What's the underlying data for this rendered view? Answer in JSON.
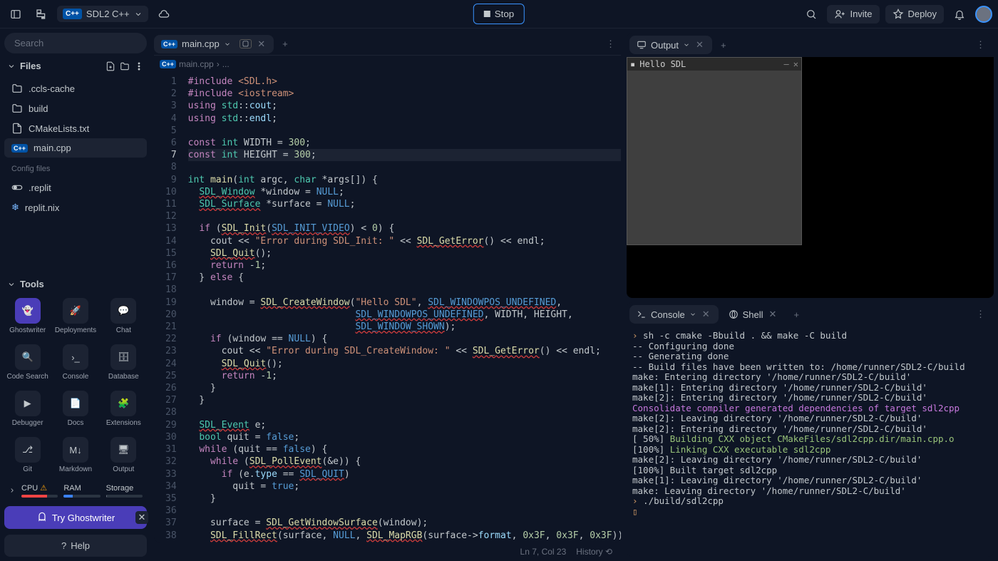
{
  "project": {
    "name": "SDL2 C++"
  },
  "topbar": {
    "stop": "Stop",
    "invite": "Invite",
    "deploy": "Deploy"
  },
  "sidebar": {
    "search_placeholder": "Search",
    "files_label": "Files",
    "files": [
      {
        "name": ".ccls-cache",
        "icon": "folder"
      },
      {
        "name": "build",
        "icon": "folder"
      },
      {
        "name": "CMakeLists.txt",
        "icon": "file"
      },
      {
        "name": "main.cpp",
        "icon": "cpp",
        "active": true
      }
    ],
    "config_label": "Config files",
    "config_files": [
      {
        "name": ".replit",
        "icon": "toggle"
      },
      {
        "name": "replit.nix",
        "icon": "nix"
      }
    ],
    "tools_label": "Tools",
    "tools": [
      {
        "name": "Ghostwriter",
        "accent": true
      },
      {
        "name": "Deployments"
      },
      {
        "name": "Chat"
      },
      {
        "name": "Code Search"
      },
      {
        "name": "Console"
      },
      {
        "name": "Database"
      },
      {
        "name": "Debugger"
      },
      {
        "name": "Docs"
      },
      {
        "name": "Extensions"
      },
      {
        "name": "Git"
      },
      {
        "name": "Markdown"
      },
      {
        "name": "Output"
      }
    ],
    "resources": {
      "cpu": {
        "label": "CPU",
        "pct": 70,
        "color": "#ef4444"
      },
      "ram": {
        "label": "RAM",
        "pct": 25,
        "color": "#3b82f6"
      },
      "storage": {
        "label": "Storage",
        "pct": 3,
        "color": "#6b7280"
      }
    },
    "ghostwriter_cta": "Try Ghostwriter",
    "help": "Help"
  },
  "editor": {
    "tab_name": "main.cpp",
    "breadcrumb": [
      "main.cpp",
      "..."
    ],
    "status": {
      "pos": "Ln 7, Col 23",
      "history": "History"
    }
  },
  "output": {
    "tab": "Output",
    "window_title": "Hello SDL"
  },
  "console": {
    "tabs": [
      {
        "name": "Console"
      },
      {
        "name": "Shell"
      }
    ],
    "lines": [
      {
        "prompt": "›",
        "text": " sh -c cmake -Bbuild . && make -C build"
      },
      {
        "text": "-- Configuring done"
      },
      {
        "text": "-- Generating done"
      },
      {
        "text": "-- Build files have been written to: /home/runner/SDL2-C/build"
      },
      {
        "text": "make: Entering directory '/home/runner/SDL2-C/build'"
      },
      {
        "text": "make[1]: Entering directory '/home/runner/SDL2-C/build'"
      },
      {
        "text": "make[2]: Entering directory '/home/runner/SDL2-C/build'"
      },
      {
        "cls": "mg",
        "text": "Consolidate compiler generated dependencies of target sdl2cpp"
      },
      {
        "text": "make[2]: Leaving directory '/home/runner/SDL2-C/build'"
      },
      {
        "text": "make[2]: Entering directory '/home/runner/SDL2-C/build'"
      },
      {
        "prefix": "[ 50%] ",
        "cls": "gr",
        "text": "Building CXX object CMakeFiles/sdl2cpp.dir/main.cpp.o"
      },
      {
        "prefix": "[100%] ",
        "cls": "gr",
        "text": "Linking CXX executable sdl2cpp"
      },
      {
        "text": "make[2]: Leaving directory '/home/runner/SDL2-C/build'"
      },
      {
        "text": "[100%] Built target sdl2cpp"
      },
      {
        "text": "make[1]: Leaving directory '/home/runner/SDL2-C/build'"
      },
      {
        "text": "make: Leaving directory '/home/runner/SDL2-C/build'"
      },
      {
        "prompt": "›",
        "text": " ./build/sdl2cpp"
      },
      {
        "prompt": "▯",
        "text": ""
      }
    ]
  },
  "code": [
    [
      [
        "kw",
        "#include"
      ],
      [
        "op",
        " "
      ],
      [
        "st",
        "<SDL.h>"
      ]
    ],
    [
      [
        "kw",
        "#include"
      ],
      [
        "op",
        " "
      ],
      [
        "st",
        "<iostream>"
      ]
    ],
    [
      [
        "kw",
        "using"
      ],
      [
        "op",
        " "
      ],
      [
        "ty",
        "std"
      ],
      [
        "op",
        "::"
      ],
      [
        "vr",
        "cout"
      ],
      [
        "op",
        ";"
      ]
    ],
    [
      [
        "kw",
        "using"
      ],
      [
        "op",
        " "
      ],
      [
        "ty",
        "std"
      ],
      [
        "op",
        "::"
      ],
      [
        "vr",
        "endl"
      ],
      [
        "op",
        ";"
      ]
    ],
    [],
    [
      [
        "kw",
        "const"
      ],
      [
        "op",
        " "
      ],
      [
        "ty",
        "int"
      ],
      [
        "op",
        " WIDTH = "
      ],
      [
        "nu",
        "300"
      ],
      [
        "op",
        ";"
      ]
    ],
    [
      [
        "kw",
        "const"
      ],
      [
        "op",
        " "
      ],
      [
        "ty",
        "int"
      ],
      [
        "op",
        " HEIGHT = "
      ],
      [
        "nu",
        "300"
      ],
      [
        "op",
        ";"
      ]
    ],
    [],
    [
      [
        "ty",
        "int"
      ],
      [
        "op",
        " "
      ],
      [
        "fn",
        "main"
      ],
      [
        "op",
        "("
      ],
      [
        "ty",
        "int"
      ],
      [
        "op",
        " argc, "
      ],
      [
        "ty",
        "char"
      ],
      [
        "op",
        " *args[]) {"
      ]
    ],
    [
      [
        "op",
        "  "
      ],
      [
        "ty ul",
        "SDL_Window"
      ],
      [
        "op",
        " *window = "
      ],
      [
        "nl",
        "NULL"
      ],
      [
        "op",
        ";"
      ]
    ],
    [
      [
        "op",
        "  "
      ],
      [
        "ty ul",
        "SDL_Surface"
      ],
      [
        "op",
        " *surface = "
      ],
      [
        "nl",
        "NULL"
      ],
      [
        "op",
        ";"
      ]
    ],
    [],
    [
      [
        "op",
        "  "
      ],
      [
        "kw",
        "if"
      ],
      [
        "op",
        " ("
      ],
      [
        "fn ul",
        "SDL_Init"
      ],
      [
        "op",
        "("
      ],
      [
        "mc ul",
        "SDL_INIT_VIDEO"
      ],
      [
        "op",
        ") < "
      ],
      [
        "nu",
        "0"
      ],
      [
        "op",
        ") {"
      ]
    ],
    [
      [
        "op",
        "    cout << "
      ],
      [
        "st",
        "\"Error during SDL_Init: \""
      ],
      [
        "op",
        " << "
      ],
      [
        "fn ul",
        "SDL_GetError"
      ],
      [
        "op",
        "() << endl;"
      ]
    ],
    [
      [
        "op",
        "    "
      ],
      [
        "fn ul",
        "SDL_Quit"
      ],
      [
        "op",
        "();"
      ]
    ],
    [
      [
        "op",
        "    "
      ],
      [
        "kw",
        "return"
      ],
      [
        "op",
        " -"
      ],
      [
        "nu",
        "1"
      ],
      [
        "op",
        ";"
      ]
    ],
    [
      [
        "op",
        "  } "
      ],
      [
        "kw",
        "else"
      ],
      [
        "op",
        " {"
      ]
    ],
    [],
    [
      [
        "op",
        "    window = "
      ],
      [
        "fn ul",
        "SDL_CreateWindow"
      ],
      [
        "op",
        "("
      ],
      [
        "st",
        "\"Hello SDL\""
      ],
      [
        "op",
        ", "
      ],
      [
        "mc ul",
        "SDL_WINDOWPOS_UNDEFINED"
      ],
      [
        "op",
        ","
      ]
    ],
    [
      [
        "op",
        "                              "
      ],
      [
        "mc ul",
        "SDL_WINDOWPOS_UNDEFINED"
      ],
      [
        "op",
        ", WIDTH, HEIGHT,"
      ]
    ],
    [
      [
        "op",
        "                              "
      ],
      [
        "mc ul",
        "SDL_WINDOW_SHOWN"
      ],
      [
        "op",
        ");"
      ]
    ],
    [
      [
        "op",
        "    "
      ],
      [
        "kw",
        "if"
      ],
      [
        "op",
        " (window == "
      ],
      [
        "nl",
        "NULL"
      ],
      [
        "op",
        ") {"
      ]
    ],
    [
      [
        "op",
        "      cout << "
      ],
      [
        "st",
        "\"Error during SDL_CreateWindow: \""
      ],
      [
        "op",
        " << "
      ],
      [
        "fn ul",
        "SDL_GetError"
      ],
      [
        "op",
        "() << endl;"
      ]
    ],
    [
      [
        "op",
        "      "
      ],
      [
        "fn ul",
        "SDL_Quit"
      ],
      [
        "op",
        "();"
      ]
    ],
    [
      [
        "op",
        "      "
      ],
      [
        "kw",
        "return"
      ],
      [
        "op",
        " -"
      ],
      [
        "nu",
        "1"
      ],
      [
        "op",
        ";"
      ]
    ],
    [
      [
        "op",
        "    }"
      ]
    ],
    [
      [
        "op",
        "  }"
      ]
    ],
    [],
    [
      [
        "op",
        "  "
      ],
      [
        "ty ul",
        "SDL_Event"
      ],
      [
        "op",
        " e;"
      ]
    ],
    [
      [
        "op",
        "  "
      ],
      [
        "ty",
        "bool"
      ],
      [
        "op",
        " quit = "
      ],
      [
        "nl",
        "false"
      ],
      [
        "op",
        ";"
      ]
    ],
    [
      [
        "op",
        "  "
      ],
      [
        "kw",
        "while"
      ],
      [
        "op",
        " (quit == "
      ],
      [
        "nl",
        "false"
      ],
      [
        "op",
        ") {"
      ]
    ],
    [
      [
        "op",
        "    "
      ],
      [
        "kw",
        "while"
      ],
      [
        "op",
        " ("
      ],
      [
        "fn ul",
        "SDL_PollEvent"
      ],
      [
        "op",
        "(&e)) {"
      ]
    ],
    [
      [
        "op",
        "      "
      ],
      [
        "kw",
        "if"
      ],
      [
        "op",
        " (e."
      ],
      [
        "vr",
        "type"
      ],
      [
        "op",
        " == "
      ],
      [
        "mc ul",
        "SDL_QUIT"
      ],
      [
        "op",
        ")"
      ]
    ],
    [
      [
        "op",
        "        quit = "
      ],
      [
        "nl",
        "true"
      ],
      [
        "op",
        ";"
      ]
    ],
    [
      [
        "op",
        "    }"
      ]
    ],
    [],
    [
      [
        "op",
        "    surface = "
      ],
      [
        "fn ul",
        "SDL_GetWindowSurface"
      ],
      [
        "op",
        "(window);"
      ]
    ],
    [
      [
        "op",
        "    "
      ],
      [
        "fn ul",
        "SDL_FillRect"
      ],
      [
        "op",
        "(surface, "
      ],
      [
        "nl",
        "NULL"
      ],
      [
        "op",
        ", "
      ],
      [
        "fn ul",
        "SDL_MapRGB"
      ],
      [
        "op",
        "(surface->"
      ],
      [
        "vr",
        "format"
      ],
      [
        "op",
        ", "
      ],
      [
        "nu",
        "0x3F"
      ],
      [
        "op",
        ", "
      ],
      [
        "nu",
        "0x3F"
      ],
      [
        "op",
        ", "
      ],
      [
        "nu",
        "0x3F"
      ],
      [
        "op",
        "));"
      ]
    ]
  ],
  "current_line": 7
}
